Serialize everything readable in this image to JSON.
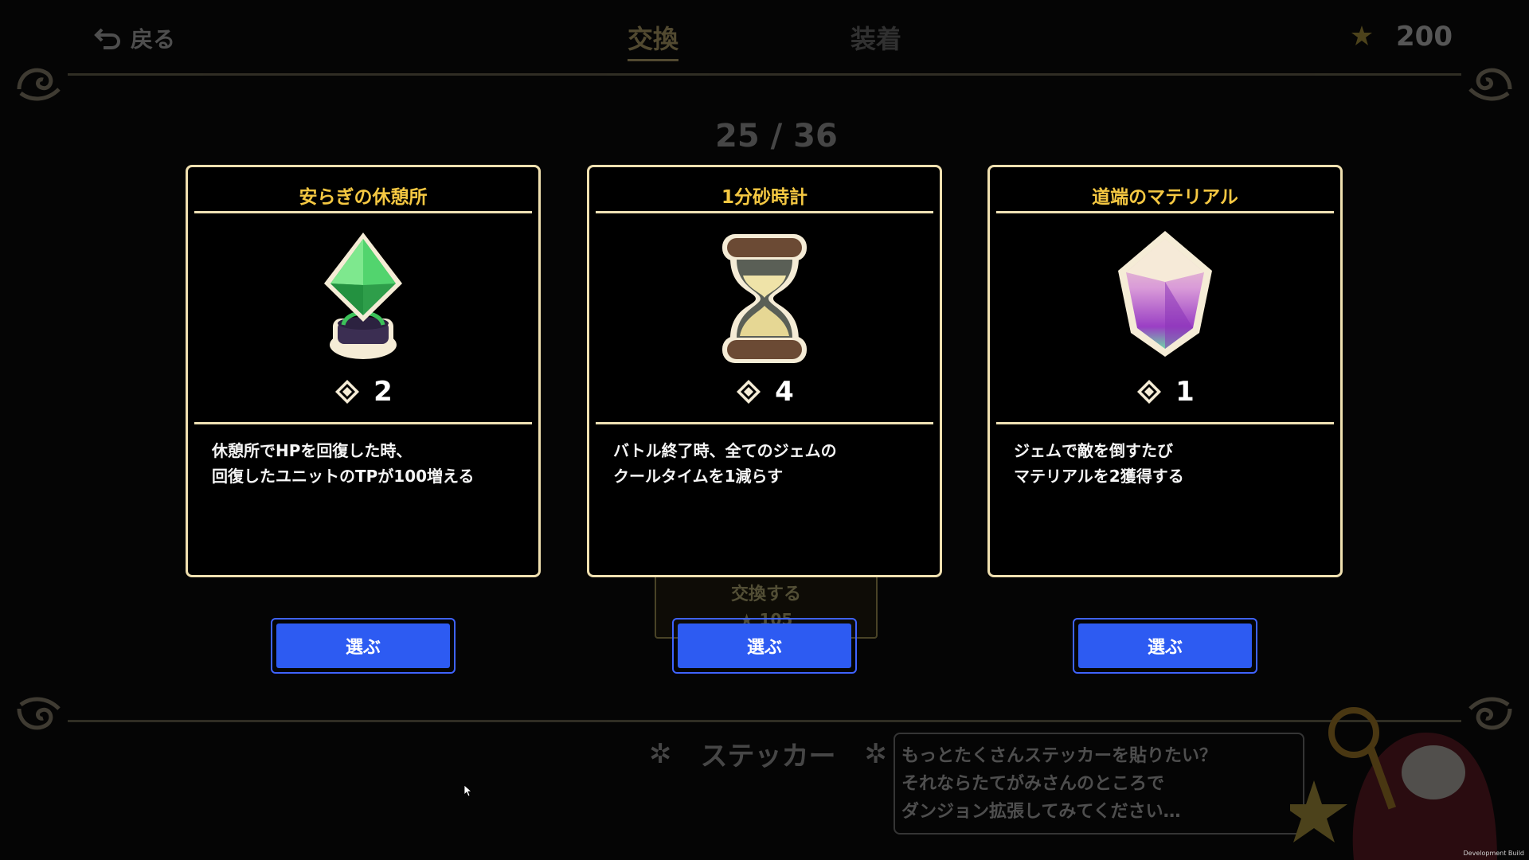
{
  "header": {
    "back_label": "戻る",
    "tabs": [
      {
        "label": "交換",
        "active": true
      },
      {
        "label": "装着",
        "active": false
      }
    ],
    "currency_value": "200"
  },
  "progress": "25 / 36",
  "background_exchange": {
    "label": "交換する",
    "cost": "105"
  },
  "sticker_section": {
    "title": "ステッカー",
    "hint_lines": [
      "もっとたくさんステッカーを貼りたい？",
      "それならたてがみさんのところで",
      "ダンジョン拡張してみてください…"
    ]
  },
  "cards": [
    {
      "title": "安らぎの休憩所",
      "icon": "green-crystal-on-pedestal-icon",
      "cost": "2",
      "desc_lines": [
        "休憩所でHPを回復した時、",
        "回復したユニットのTPが100増える"
      ],
      "button_label": "選ぶ"
    },
    {
      "title": "1分砂時計",
      "icon": "hourglass-icon",
      "cost": "4",
      "desc_lines": [
        "バトル終了時、全てのジェムの",
        "クールタイムを1減らす"
      ],
      "button_label": "選ぶ"
    },
    {
      "title": "道端のマテリアル",
      "icon": "purple-crystal-icon",
      "cost": "1",
      "desc_lines": [
        "ジェムで敵を倒すたび",
        "マテリアルを2獲得する"
      ],
      "button_label": "選ぶ"
    }
  ],
  "footer": {
    "build_label": "Development Build"
  },
  "colors": {
    "card_border": "#f0e0b0",
    "card_title": "#f5c842",
    "button_fill": "#2d5bf2",
    "button_border": "#3f63ff"
  }
}
